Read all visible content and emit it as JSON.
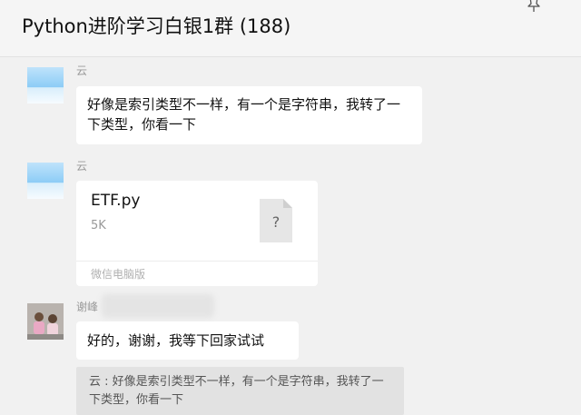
{
  "chat": {
    "title": "Python进阶学习白银1群 (188)"
  },
  "messages": [
    {
      "sender": "云",
      "text": "好像是索引类型不一样，有一个是字符串，我转了一下类型，你看一下"
    },
    {
      "sender": "云",
      "file": {
        "name": "ETF.py",
        "size": "5K",
        "icon_glyph": "?",
        "source": "微信电脑版"
      }
    },
    {
      "sender": "谢峰",
      "text": "好的，谢谢，我等下回家试试",
      "quote": "云 : 好像是索引类型不一样，有一个是字符串，我转了一下类型，你看一下"
    }
  ],
  "icons": {
    "pin": "pin-icon"
  }
}
